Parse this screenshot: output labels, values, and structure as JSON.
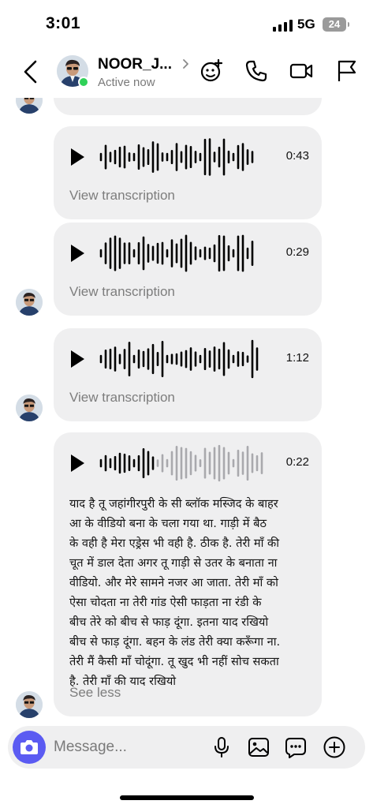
{
  "status_bar": {
    "time": "3:01",
    "network": "5G",
    "battery": "24"
  },
  "header": {
    "contact_name": "NOOR_J...",
    "status": "Active now",
    "icons": [
      "back-icon",
      "chevron-right-icon",
      "effects-icon",
      "phone-icon",
      "video-icon",
      "flag-icon"
    ]
  },
  "messages": [
    {
      "type": "voice",
      "duration": "0:43",
      "action": "View transcription"
    },
    {
      "type": "voice",
      "duration": "0:29",
      "action": "View transcription"
    },
    {
      "type": "voice",
      "duration": "1:12",
      "action": "View transcription"
    },
    {
      "type": "voice",
      "duration": "0:22",
      "played_fraction": 0.33,
      "transcript_lines": [
        "याद है तू जहांगीरपुरी के सी ब्लॉक मस्जिद के बाहर",
        "आ के वीडियो बना के चला गया था. गाड़ी में बैठ",
        "के वही है मेरा एड्रेस भी वही है. ठीक है. तेरी माँ की",
        "चूत में डाल देता अगर तू गाड़ी से उतर के बनाता ना",
        "वीडियो. और मेरे सामने नजर आ जाता. तेरी माँ को",
        "ऐसा चोदता ना तेरी गांड ऐसी फाड़ता ना रंडी के",
        "बीच तेरे को बीच से फाड़ दूंगा. इतना याद रखियो",
        "बीच से फाड़ दूंगा. बहन के लंड तेरी क्या करूँगा ना.",
        "तेरी मैं कैसी माँ चोदूंगा. तू खुद भी नहीं सोच सकता",
        "है. तेरी माँ की याद रखियो"
      ],
      "action": "See less"
    }
  ],
  "composer": {
    "placeholder": "Message...",
    "icons": [
      "camera-icon",
      "microphone-icon",
      "gallery-icon",
      "sticker-icon",
      "add-icon"
    ]
  },
  "colors": {
    "accent": "#5b5bf2",
    "online": "#2fd158",
    "bubble": "#efeff0",
    "wave_played": "#000000",
    "wave_unplayed": "#a9a9ad"
  }
}
